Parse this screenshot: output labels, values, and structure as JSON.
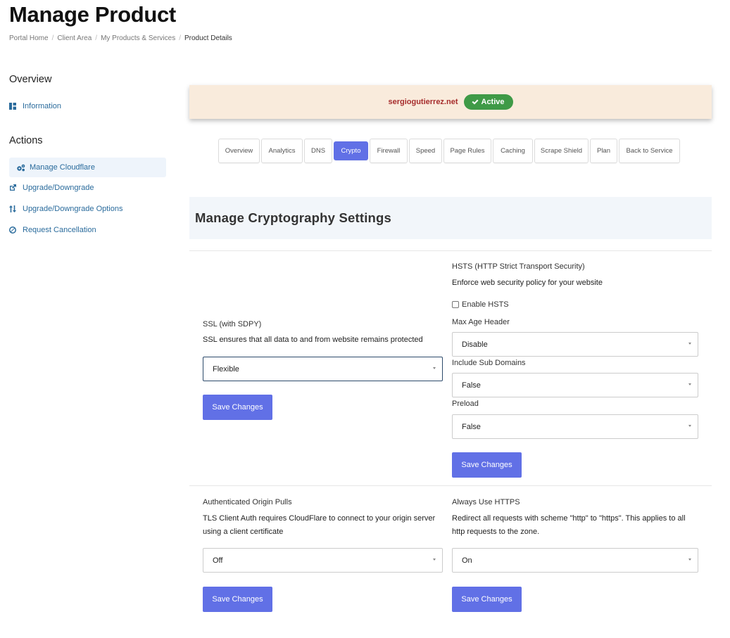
{
  "page": {
    "title": "Manage Product"
  },
  "breadcrumb": [
    "Portal Home",
    "Client Area",
    "My Products & Services",
    "Product Details"
  ],
  "sidebar": {
    "overview_heading": "Overview",
    "overview_items": [
      {
        "label": "Information",
        "icon": "dashboard-icon"
      }
    ],
    "actions_heading": "Actions",
    "action_items": [
      {
        "label": "Manage Cloudflare",
        "icon": "gears-icon",
        "active": true
      },
      {
        "label": "Upgrade/Downgrade",
        "icon": "external-link-icon"
      },
      {
        "label": "Upgrade/Downgrade Options",
        "icon": "sort-arrows-icon"
      },
      {
        "label": "Request Cancellation",
        "icon": "ban-icon"
      }
    ]
  },
  "status": {
    "domain": "sergiogutierrez.net",
    "badge": "Active",
    "domain_color": "#a62c2c",
    "badge_color": "#3f9a47"
  },
  "tabs": [
    "Overview",
    "Analytics",
    "DNS",
    "Crypto",
    "Firewall",
    "Speed",
    "Page Rules",
    "Caching",
    "Scrape Shield",
    "Plan",
    "Back to Service"
  ],
  "active_tab": "Crypto",
  "section_title": "Manage Cryptography Settings",
  "ssl": {
    "label": "SSL (with SDPY)",
    "description": "SSL ensures that all data to and from website remains protected",
    "value": "Flexible",
    "save": "Save Changes"
  },
  "hsts": {
    "label": "HSTS (HTTP Strict Transport Security)",
    "description": "Enforce web security policy for your website",
    "enable_label": "Enable HSTS",
    "max_age_label": "Max Age Header",
    "max_age_value": "Disable",
    "subdomains_label": "Include Sub Domains",
    "subdomains_value": "False",
    "preload_label": "Preload",
    "preload_value": "False",
    "save": "Save Changes"
  },
  "origin_pulls": {
    "label": "Authenticated Origin Pulls",
    "description_line1": "TLS Client Auth requires CloudFlare to connect to your origin server",
    "description_line2": "using a client certificate",
    "value": "Off",
    "save": "Save Changes"
  },
  "https": {
    "label": "Always Use HTTPS",
    "description_line1": "Redirect all requests with scheme \"http\" to \"https\". This applies to all",
    "description_line2": "http requests to the zone.",
    "value": "On",
    "save": "Save Changes"
  },
  "colors": {
    "accent": "#6170e6",
    "link": "#2a6b9c",
    "status_bg": "#f9ebdc"
  }
}
